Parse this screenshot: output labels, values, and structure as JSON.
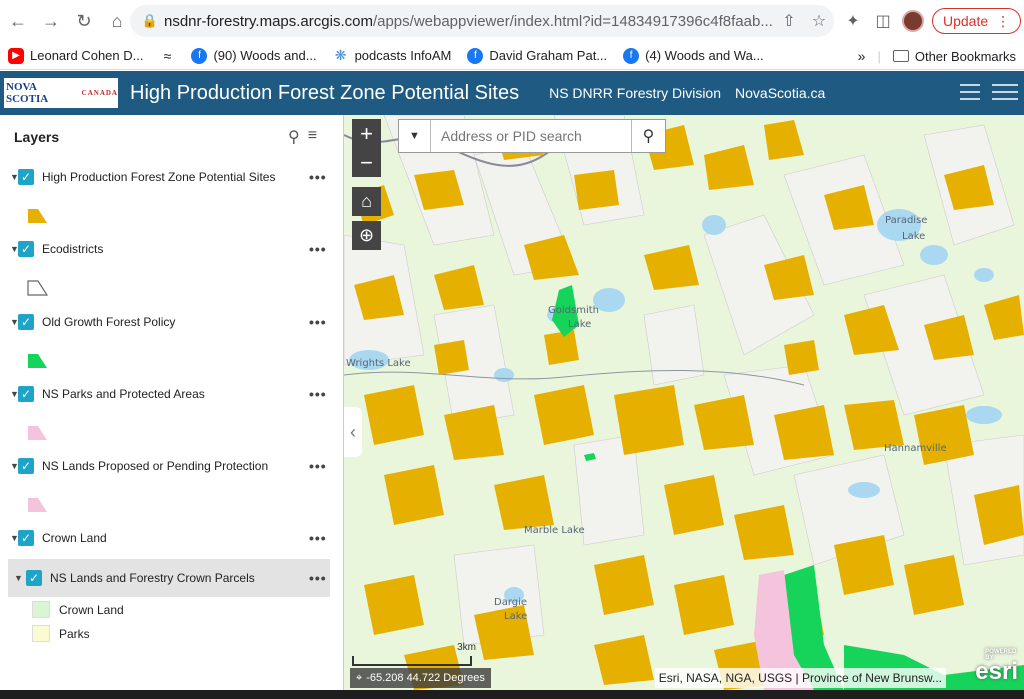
{
  "browser": {
    "url_host": "nsdnr-forestry.maps.arcgis.com",
    "url_path": "/apps/webappviewer/index.html?id=14834917396c4f8faab...",
    "update_label": "Update",
    "bookmarks": [
      {
        "icon": "youtube-icon",
        "label": "Leonard Cohen D..."
      },
      {
        "icon": "wifi-icon",
        "label": ""
      },
      {
        "icon": "facebook-icon",
        "label": "(90) Woods and..."
      },
      {
        "icon": "podcast-icon",
        "label": "podcasts InfoAM"
      },
      {
        "icon": "facebook-icon",
        "label": "David Graham Pat..."
      },
      {
        "icon": "facebook-icon",
        "label": "(4) Woods and Wa..."
      }
    ],
    "other_bookmarks": "Other Bookmarks"
  },
  "header": {
    "logo_text": "NOVA SCOTIA",
    "logo_sub": "CANADA",
    "title": "High Production Forest Zone Potential Sites",
    "link1": "NS DNRR Forestry Division",
    "link2": "NovaScotia.ca"
  },
  "panel": {
    "title": "Layers",
    "layers": [
      {
        "name": "High Production Forest Zone Potential Sites",
        "color": "#e6b000"
      },
      {
        "name": "Ecodistricts",
        "color": "#ffffff"
      },
      {
        "name": "Old Growth Forest Policy",
        "color": "#16d35a"
      },
      {
        "name": "NS Parks and Protected Areas",
        "color": "#f4c4dc"
      },
      {
        "name": "NS Lands Proposed or Pending Protection",
        "color": "#f4c4dc"
      },
      {
        "name": "Crown Land",
        "color": ""
      }
    ],
    "sublayer": "NS Lands and Forestry Crown Parcels",
    "legend": [
      {
        "label": "Crown Land",
        "color": "#d9f5d4"
      },
      {
        "label": "Parks",
        "color": "#fbfbd2"
      }
    ]
  },
  "map": {
    "search_placeholder": "Address or PID search",
    "labels": {
      "paradise": "Paradise",
      "lake1": "Lake",
      "goldsmith": "Goldsmith",
      "lake2": "Lake",
      "wrights": "Wrights Lake",
      "hannamville": "Hannamville",
      "marble": "Marble Lake",
      "dargie": "Dargie",
      "lake3": "Lake"
    },
    "scale_label": "3km",
    "coordinates": "-65.208 44.722 Degrees",
    "attribution": "Esri, NASA, NGA, USGS | Province of New Brunsw...",
    "esri_brand": "esri",
    "esri_powered": "POWERED BY"
  }
}
